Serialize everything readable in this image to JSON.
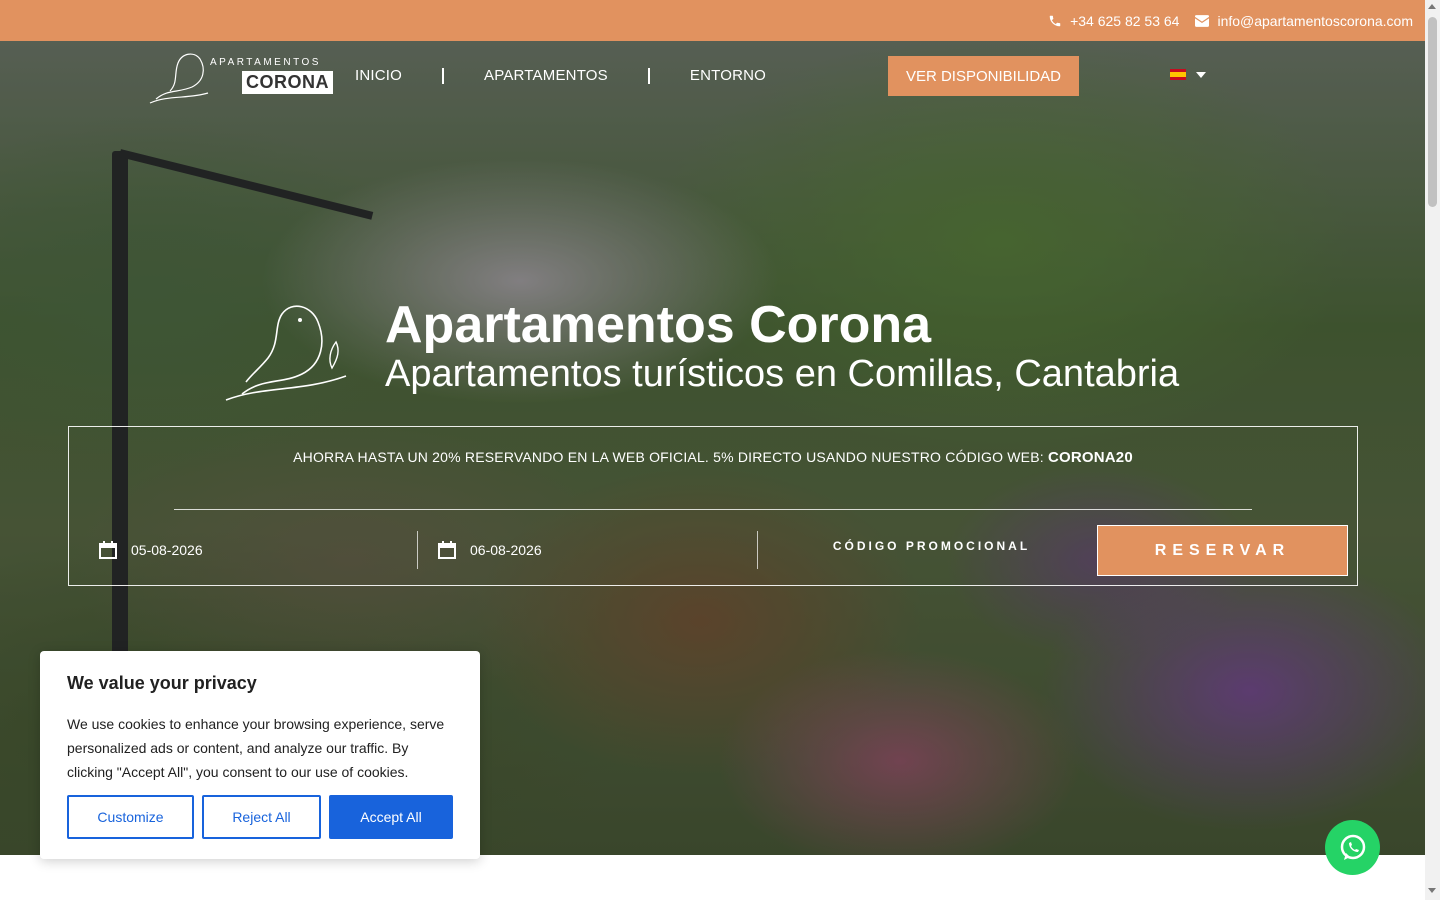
{
  "topbar": {
    "phone": "+34 625 82 53 64",
    "email": "info@apartamentoscorona.com",
    "phone_icon": "phone-icon",
    "email_icon": "envelope-icon"
  },
  "logo": {
    "small": "APARTAMENTOS",
    "big": "CORONA"
  },
  "nav": {
    "items": [
      {
        "label": "INICIO"
      },
      {
        "label": "APARTAMENTOS"
      },
      {
        "label": "ENTORNO"
      }
    ],
    "cta": "VER DISPONIBILIDAD",
    "language_icon": "spain-flag-icon"
  },
  "hero": {
    "title": "Apartamentos Corona",
    "subtitle": "Apartamentos turísticos en Comillas, Cantabria"
  },
  "booking": {
    "promo_text": "AHORRA HASTA UN 20% RESERVANDO EN LA WEB OFICIAL. 5% DIRECTO USANDO NUESTRO CÓDIGO WEB: ",
    "promo_code_value": "CORONA20",
    "checkin": "05-08-2026",
    "checkout": "06-08-2026",
    "promo_code_label": "CÓDIGO PROMOCIONAL",
    "reserve": "RESERVAR"
  },
  "cookie": {
    "title": "We value your privacy",
    "body": "We use cookies to enhance your browsing experience, serve personalized ads or content, and analyze our traffic. By clicking \"Accept All\", you consent to our use of cookies.",
    "customize": "Customize",
    "reject": "Reject All",
    "accept": "Accept All"
  },
  "colors": {
    "accent": "#e1925f",
    "cookie_blue": "#1863dc",
    "whatsapp": "#25d366"
  }
}
